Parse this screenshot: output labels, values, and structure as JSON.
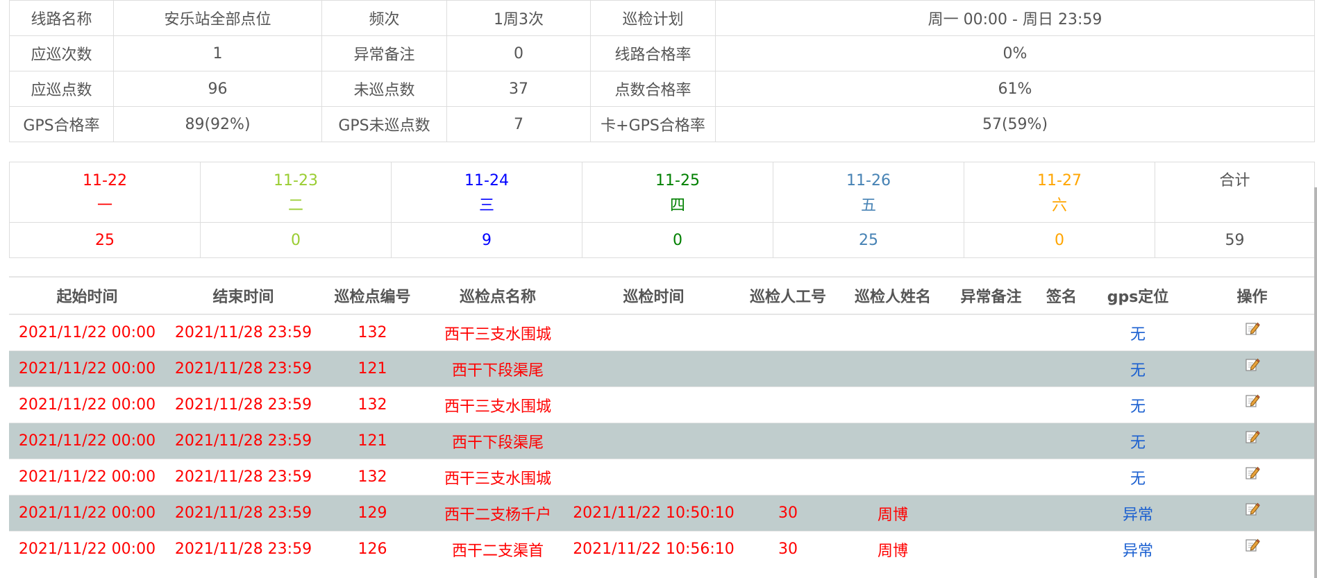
{
  "summary": {
    "rows": [
      [
        {
          "label": "线路名称",
          "value": "安乐站全部点位"
        },
        {
          "label": "频次",
          "value": "1周3次"
        },
        {
          "label": "巡检计划",
          "value": "周一 00:00 - 周日 23:59"
        }
      ],
      [
        {
          "label": "应巡次数",
          "value": "1"
        },
        {
          "label": "异常备注",
          "value": "0"
        },
        {
          "label": "线路合格率",
          "value": "0%"
        }
      ],
      [
        {
          "label": "应巡点数",
          "value": "96"
        },
        {
          "label": "未巡点数",
          "value": "37"
        },
        {
          "label": "点数合格率",
          "value": "61%"
        }
      ],
      [
        {
          "label": "GPS合格率",
          "value": "89(92%)"
        },
        {
          "label": "GPS未巡点数",
          "value": "7"
        },
        {
          "label": "卡+GPS合格率",
          "value": "57(59%)"
        }
      ]
    ]
  },
  "days": {
    "items": [
      {
        "date": "11-22",
        "weekday": "一",
        "count": "25",
        "color": "#ff0000"
      },
      {
        "date": "11-23",
        "weekday": "二",
        "count": "0",
        "color": "#9acd32"
      },
      {
        "date": "11-24",
        "weekday": "三",
        "count": "9",
        "color": "#0000ff"
      },
      {
        "date": "11-25",
        "weekday": "四",
        "count": "0",
        "color": "#008000"
      },
      {
        "date": "11-26",
        "weekday": "五",
        "count": "25",
        "color": "#4682b4"
      },
      {
        "date": "11-27",
        "weekday": "六",
        "count": "0",
        "color": "#ffa500"
      }
    ],
    "total": {
      "label": "合计",
      "count": "59",
      "color": "#555555"
    }
  },
  "records": {
    "headers": [
      "起始时间",
      "结束时间",
      "巡检点编号",
      "巡检点名称",
      "巡检时间",
      "巡检人工号",
      "巡检人姓名",
      "异常备注",
      "签名",
      "gps定位",
      "操作"
    ],
    "rows": [
      {
        "start": "2021/11/22 00:00",
        "end": "2021/11/28 23:59",
        "point_no": "132",
        "point_name": "西干三支水围城",
        "time": "",
        "worker_no": "",
        "worker_name": "",
        "remark": "",
        "sign": "",
        "gps": "无"
      },
      {
        "start": "2021/11/22 00:00",
        "end": "2021/11/28 23:59",
        "point_no": "121",
        "point_name": "西干下段渠尾",
        "time": "",
        "worker_no": "",
        "worker_name": "",
        "remark": "",
        "sign": "",
        "gps": "无"
      },
      {
        "start": "2021/11/22 00:00",
        "end": "2021/11/28 23:59",
        "point_no": "132",
        "point_name": "西干三支水围城",
        "time": "",
        "worker_no": "",
        "worker_name": "",
        "remark": "",
        "sign": "",
        "gps": "无"
      },
      {
        "start": "2021/11/22 00:00",
        "end": "2021/11/28 23:59",
        "point_no": "121",
        "point_name": "西干下段渠尾",
        "time": "",
        "worker_no": "",
        "worker_name": "",
        "remark": "",
        "sign": "",
        "gps": "无"
      },
      {
        "start": "2021/11/22 00:00",
        "end": "2021/11/28 23:59",
        "point_no": "132",
        "point_name": "西干三支水围城",
        "time": "",
        "worker_no": "",
        "worker_name": "",
        "remark": "",
        "sign": "",
        "gps": "无"
      },
      {
        "start": "2021/11/22 00:00",
        "end": "2021/11/28 23:59",
        "point_no": "129",
        "point_name": "西干二支杨千户",
        "time": "2021/11/22 10:50:10",
        "worker_no": "30",
        "worker_name": "周博",
        "remark": "",
        "sign": "",
        "gps": "异常"
      },
      {
        "start": "2021/11/22 00:00",
        "end": "2021/11/28 23:59",
        "point_no": "126",
        "point_name": "西干二支渠首",
        "time": "2021/11/22 10:56:10",
        "worker_no": "30",
        "worker_name": "周博",
        "remark": "",
        "sign": "",
        "gps": "异常"
      }
    ],
    "action_icon": "edit-icon",
    "text_color": "#ff0000",
    "gps_color": "#1a5fd0",
    "alt_row_color": "#c0cdcd"
  }
}
